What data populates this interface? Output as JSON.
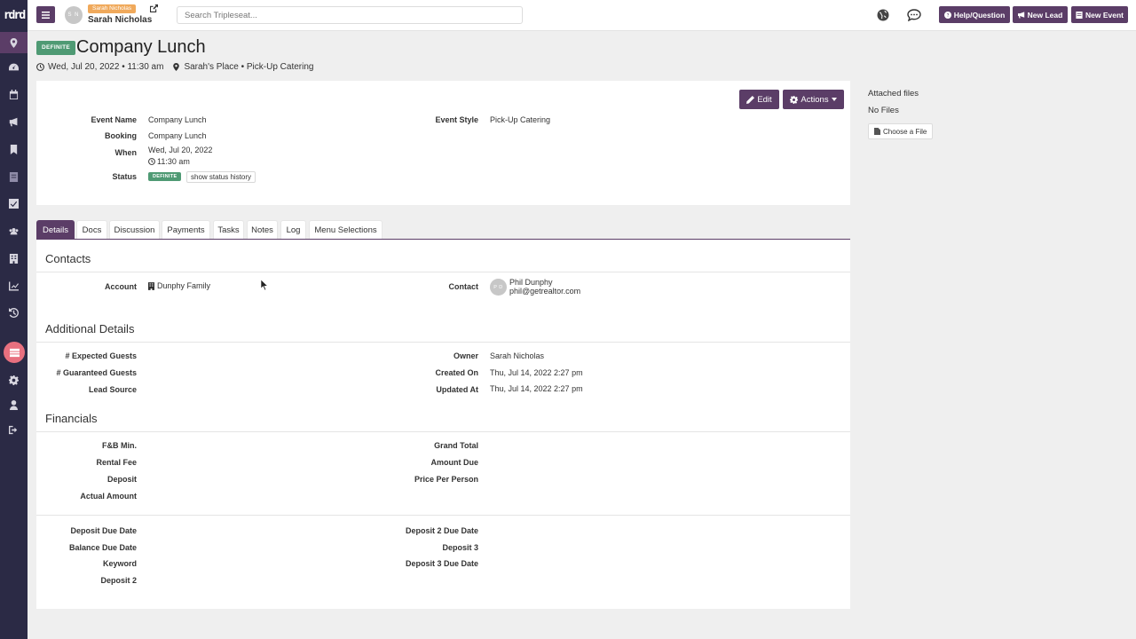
{
  "sidebar": {
    "logo": "rdrd",
    "icons": [
      "location-pin-icon",
      "dashboard-icon",
      "calendar-icon",
      "megaphone-icon",
      "bookmark-icon",
      "document-icon",
      "checklist-icon",
      "users-icon",
      "building-icon",
      "chart-icon",
      "history-icon",
      "catering-icon",
      "settings-icon",
      "profile-icon",
      "logout-icon"
    ]
  },
  "header": {
    "avatar_initials": "S N",
    "user_badge": "Sarah Nicholas",
    "user_name": "Sarah Nicholas",
    "search_placeholder": "Search Tripleseat...",
    "help_label": "Help/Question",
    "new_lead_label": "New Lead",
    "new_event_label": "New Event"
  },
  "event": {
    "status": "DEFINITE",
    "title": "Company Lunch",
    "datetime": "Wed, Jul 20, 2022 • 11:30 am",
    "location": "Sarah's Place • Pick-Up Catering",
    "edit_label": "Edit",
    "actions_label": "Actions",
    "fields": {
      "event_name_label": "Event Name",
      "event_name": "Company Lunch",
      "booking_label": "Booking",
      "booking": "Company Lunch",
      "when_label": "When",
      "when_date": "Wed, Jul 20, 2022",
      "when_time": "11:30 am",
      "status_label": "Status",
      "status_value": "DEFINITE",
      "status_history": "show status history",
      "event_style_label": "Event Style",
      "event_style": "Pick-Up Catering"
    }
  },
  "files": {
    "title": "Attached files",
    "empty": "No Files",
    "choose_label": "Choose a File"
  },
  "tabs": [
    "Details",
    "Docs",
    "Discussion",
    "Payments",
    "Tasks",
    "Notes",
    "Log",
    "Menu Selections"
  ],
  "contacts": {
    "title": "Contacts",
    "account_label": "Account",
    "account_value": "Dunphy Family",
    "contact_label": "Contact",
    "contact_initials": "P D",
    "contact_name": "Phil Dunphy",
    "contact_email": "phil@getrealtor.com"
  },
  "additional": {
    "title": "Additional Details",
    "expected_guests_label": "# Expected Guests",
    "guaranteed_guests_label": "# Guaranteed Guests",
    "lead_source_label": "Lead Source",
    "owner_label": "Owner",
    "owner": "Sarah Nicholas",
    "created_on_label": "Created On",
    "created_on": "Thu, Jul 14, 2022 2:27 pm",
    "updated_at_label": "Updated At",
    "updated_at": "Thu, Jul 14, 2022 2:27 pm"
  },
  "financials": {
    "title": "Financials",
    "fb_min": "F&B Min.",
    "rental_fee": "Rental Fee",
    "deposit": "Deposit",
    "actual_amount": "Actual Amount",
    "grand_total": "Grand Total",
    "amount_due": "Amount Due",
    "price_per_person": "Price Per Person",
    "deposit_due_date": "Deposit Due Date",
    "balance_due_date": "Balance Due Date",
    "keyword": "Keyword",
    "deposit_2": "Deposit 2",
    "deposit_2_due_date": "Deposit 2 Due Date",
    "deposit_3": "Deposit 3",
    "deposit_3_due_date": "Deposit 3 Due Date"
  },
  "colors": {
    "brand": "#5b3d67",
    "sidebar": "#2b2a45",
    "definite": "#4f9a74",
    "user_badge": "#f0a95b",
    "catering_highlight": "#e8707f"
  }
}
